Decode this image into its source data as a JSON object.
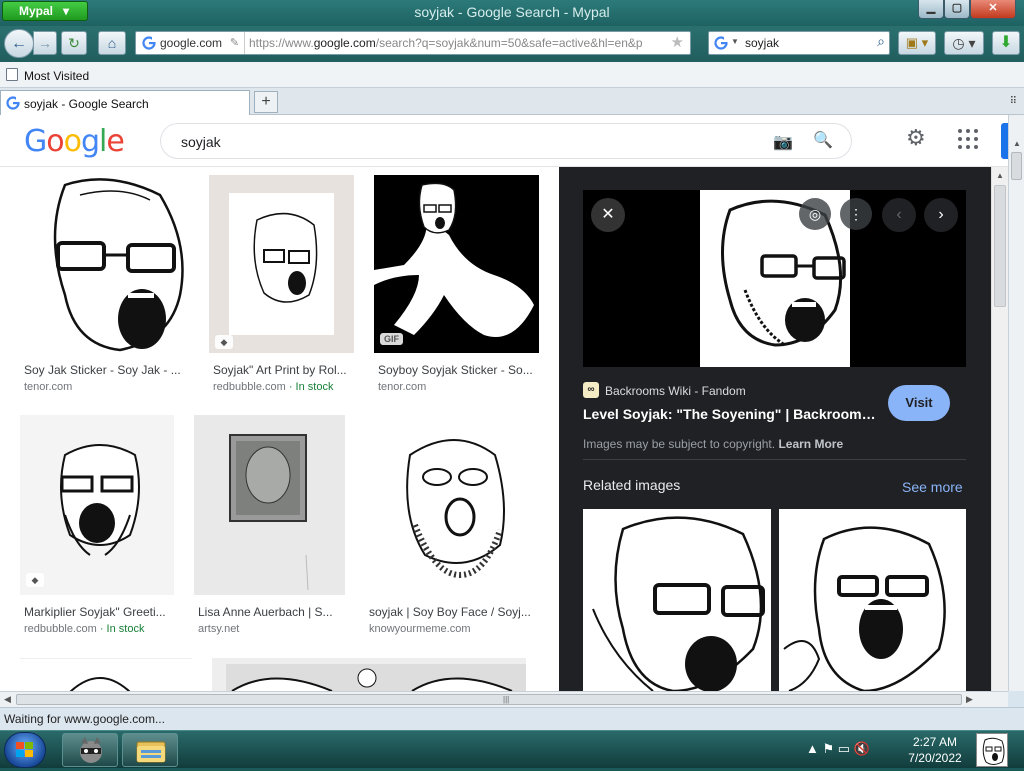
{
  "window": {
    "title": "soyjak - Google Search - Mypal",
    "app_menu": "Mypal",
    "min": "▁",
    "max": "▢",
    "close": "✕"
  },
  "nav": {
    "back": "←",
    "forward": "→",
    "reload": "↻",
    "home": "⌂",
    "url_site": "google.com",
    "url_prefix": "https://www.",
    "url_domain": "google.com",
    "url_rest": "/search?q=soyjak&num=50&safe=active&hl=en&p",
    "search_value": "soyjak",
    "bookmarks": "▣ ▾",
    "history": "◷ ▾",
    "downloads": "⬇"
  },
  "bookmarks_bar": {
    "most_visited": "Most Visited"
  },
  "tabs": {
    "active_label": "soyjak - Google Search",
    "new_tab": "+"
  },
  "google": {
    "logo_letters": [
      "G",
      "o",
      "o",
      "g",
      "l",
      "e"
    ],
    "logo_colors": [
      "#4285f4",
      "#ea4335",
      "#fbbc05",
      "#4285f4",
      "#34a853",
      "#ea4335"
    ],
    "query": "soyjak",
    "camera": "📷",
    "search": "🔍",
    "settings": "⚙"
  },
  "results": [
    {
      "title": "Soy Jak Sticker - Soy Jak - ...",
      "source": "tenor.com",
      "stock": "",
      "badge": ""
    },
    {
      "title": "Soyjak\" Art Print by Rol...",
      "source": "redbubble.com",
      "stock": " · In stock",
      "badge": "tag"
    },
    {
      "title": "Soyboy Soyjak Sticker - So...",
      "source": "tenor.com",
      "stock": "",
      "badge": "GIF"
    },
    {
      "title": "Markiplier Soyjak\" Greeti...",
      "source": "redbubble.com",
      "stock": " · In stock",
      "badge": "tag"
    },
    {
      "title": "Lisa Anne Auerbach | S...",
      "source": "artsy.net",
      "stock": "",
      "badge": ""
    },
    {
      "title": "soyjak | Soy Boy Face / Soyj...",
      "source": "knowyourmeme.com",
      "stock": "",
      "badge": ""
    }
  ],
  "panel": {
    "close": "✕",
    "lens": "◎",
    "more": "⋮",
    "prev": "‹",
    "next": "›",
    "source_icon": "∞",
    "source_name": "Backrooms Wiki - Fandom",
    "title": "Level Soyjak: \"The Soyening\" | Backrooms ...",
    "visit": "Visit",
    "copyright_text": "Images may be subject to copyright. ",
    "learn_more": "Learn More",
    "related_heading": "Related images",
    "see_more": "See more"
  },
  "status": {
    "text": "Waiting for www.google.com..."
  },
  "taskbar": {
    "tray_icons": "▲   ⚑   ▭   🔇",
    "time": "2:27 AM",
    "date": "7/20/2022"
  }
}
